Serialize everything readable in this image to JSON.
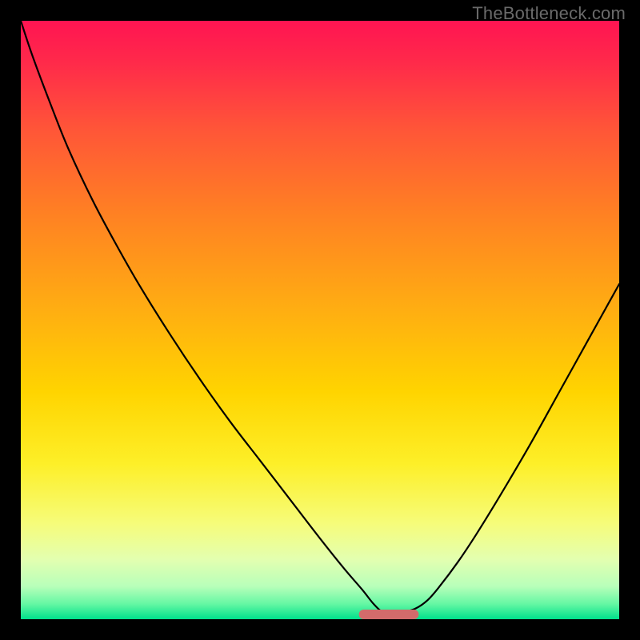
{
  "watermark": "TheBottleneck.com",
  "chart_data": {
    "type": "line",
    "title": "",
    "xlabel": "",
    "ylabel": "",
    "xlim": [
      0,
      100
    ],
    "ylim": [
      0,
      100
    ],
    "grid": false,
    "legend": false,
    "x": [
      0,
      2,
      5,
      8,
      12,
      16,
      20,
      25,
      30,
      35,
      40,
      45,
      50,
      54,
      57,
      59,
      60.5,
      62,
      64,
      66,
      68,
      70,
      73,
      76,
      80,
      85,
      90,
      95,
      100
    ],
    "y": [
      100,
      94,
      86,
      78.5,
      70,
      62.5,
      55.5,
      47.5,
      40,
      33,
      26.5,
      20,
      13.5,
      8.5,
      5,
      2.5,
      1.2,
      1.0,
      1.2,
      1.8,
      3.2,
      5.5,
      9.5,
      14,
      20.5,
      29,
      38,
      47,
      56
    ],
    "baseline_marker": {
      "type": "pill",
      "x_center": 61.5,
      "x_halfwidth": 5,
      "y": 0.8,
      "height": 1.6,
      "color": "#d36b6b"
    },
    "background_gradient": {
      "stops": [
        {
          "offset": 0.0,
          "color": "#ff1452"
        },
        {
          "offset": 0.07,
          "color": "#ff2a4a"
        },
        {
          "offset": 0.18,
          "color": "#ff5538"
        },
        {
          "offset": 0.32,
          "color": "#ff8023"
        },
        {
          "offset": 0.48,
          "color": "#ffad12"
        },
        {
          "offset": 0.62,
          "color": "#ffd400"
        },
        {
          "offset": 0.74,
          "color": "#fdef28"
        },
        {
          "offset": 0.84,
          "color": "#f6fc7a"
        },
        {
          "offset": 0.9,
          "color": "#e3ffb0"
        },
        {
          "offset": 0.945,
          "color": "#b8ffba"
        },
        {
          "offset": 0.975,
          "color": "#63f7a3"
        },
        {
          "offset": 1.0,
          "color": "#00e08b"
        }
      ]
    }
  }
}
